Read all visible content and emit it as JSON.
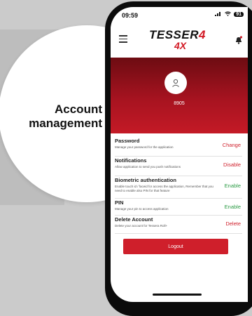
{
  "callout": {
    "line1": "Account",
    "line2": "management"
  },
  "status_bar": {
    "time": "09:59",
    "battery": "91"
  },
  "header": {
    "logo_main": "TESSER",
    "logo_accent": "4",
    "logo_sub": "4X",
    "icons": [
      "menu-icon",
      "bell-icon"
    ]
  },
  "profile": {
    "user_id": "8905",
    "avatar_icon": "user-icon"
  },
  "settings": [
    {
      "title": "Password",
      "description": "Manage your password for the application",
      "action": "Change"
    },
    {
      "title": "Notifications",
      "description": "Allow application to send you push notifications",
      "action": "Disable"
    },
    {
      "title": "Biometric authentication",
      "description": "Enable touch id / faceid for access the application, Remember that you need to enable also PIN for that feature",
      "action": "Enable"
    },
    {
      "title": "PIN",
      "description": "Manage your pin to access application",
      "action": "Enable"
    },
    {
      "title": "Delete Account",
      "description": "Delete your account for Tessera Roll+",
      "action": "Delete"
    }
  ],
  "logout_label": "Logout",
  "colors": {
    "brand_red": "#cf1f2b",
    "enable_green": "#2c9b45",
    "hero_dark": "#6d0c12"
  }
}
